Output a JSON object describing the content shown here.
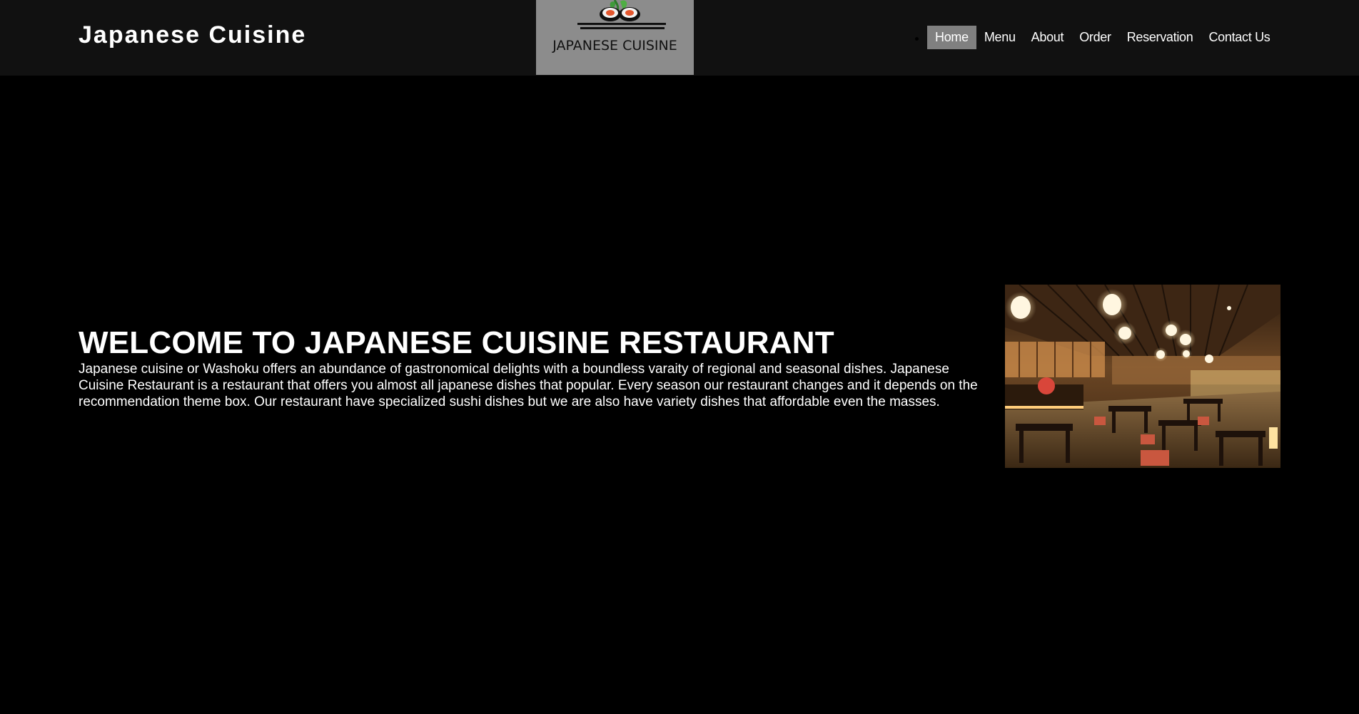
{
  "header": {
    "site_title": "Japanese Cuisine",
    "logo_text": "JAPANESE CUISINE"
  },
  "nav": {
    "items": [
      {
        "label": "Home",
        "active": true
      },
      {
        "label": "Menu"
      },
      {
        "label": "About"
      },
      {
        "label": "Order"
      },
      {
        "label": "Reservation"
      },
      {
        "label": "Contact Us"
      }
    ]
  },
  "hero": {
    "heading": "WELCOME TO JAPANESE CUISINE RESTAURANT",
    "paragraph": "Japanese cuisine or Washoku offers an abundance of gastronomical delights with a boundless varaity of regional and seasonal dishes. Japanese Cuisine Restaurant is a restaurant that offers you almost all japanese dishes that popular. Every season our restaurant changes and it depends on the recommendation theme box. Our restaurant have specialized sushi dishes but we are also have variety dishes that affordable even the masses."
  },
  "colors": {
    "header_bg": "#111111",
    "page_bg": "#000000",
    "logo_bg": "#8c8c8c",
    "nav_active_bg": "#808080",
    "text": "#ffffff"
  }
}
